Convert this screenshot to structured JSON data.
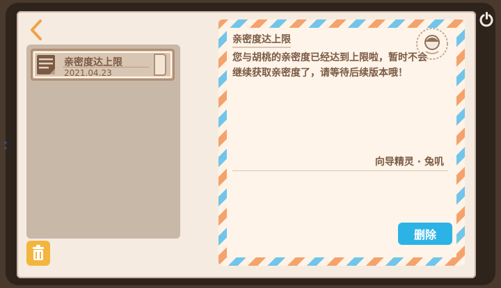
{
  "mailbox": {
    "items": [
      {
        "title": "亲密度达上限",
        "date": "2021.04.23"
      }
    ]
  },
  "letter": {
    "title": "亲密度达上限",
    "body": "您与胡桃的亲密度已经达到上限啦，暂时不会继续获取亲密度了，请等待后续版本哦！",
    "signature": "向导精灵 · 兔叽"
  },
  "actions": {
    "delete_label": "删除"
  },
  "colors": {
    "accent": "#2bb3e6",
    "airmail_orange": "#f3a36b",
    "airmail_blue": "#71c5ea",
    "text_brown": "#7a5a44",
    "panel": "#c8b8a8",
    "paper": "#fff4e9",
    "trash_yellow": "#f3b53d"
  },
  "icons": {
    "back": "chevron-left-icon",
    "mail": "mail-icon",
    "trash": "trash-icon",
    "power": "power-icon",
    "stamp": "stamp-icon"
  }
}
